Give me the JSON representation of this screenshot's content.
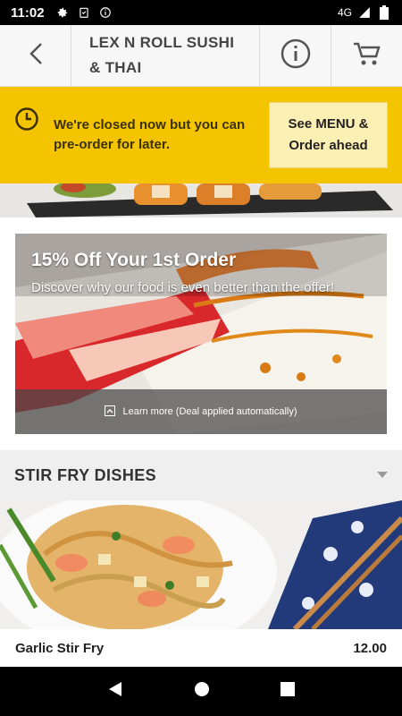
{
  "status_bar": {
    "time": "11:02",
    "network": "4G",
    "icons": [
      "gear-icon",
      "clipboard-check-icon",
      "info-icon",
      "signal-icon",
      "battery-icon"
    ]
  },
  "header": {
    "title": "LEX N ROLL SUSHI & THAI",
    "icons": [
      "back-icon",
      "info-icon",
      "cart-icon"
    ]
  },
  "closed_banner": {
    "message": "We're closed now but you can pre-order for later.",
    "button_label": "See MENU & Order ahead",
    "background_color": "#f5c400",
    "icon": "clock-icon"
  },
  "promo": {
    "title": "15% Off Your 1st Order",
    "subtitle": "Discover why our food is even better than the offer!",
    "footer_text": "Learn more (Deal applied automatically)"
  },
  "menu_section": {
    "title": "STIR FRY DISHES",
    "items": [
      {
        "name": "Garlic Stir Fry",
        "price": "12.00"
      }
    ]
  },
  "nav": {
    "icons": [
      "nav-back-icon",
      "nav-home-icon",
      "nav-recents-icon"
    ]
  }
}
